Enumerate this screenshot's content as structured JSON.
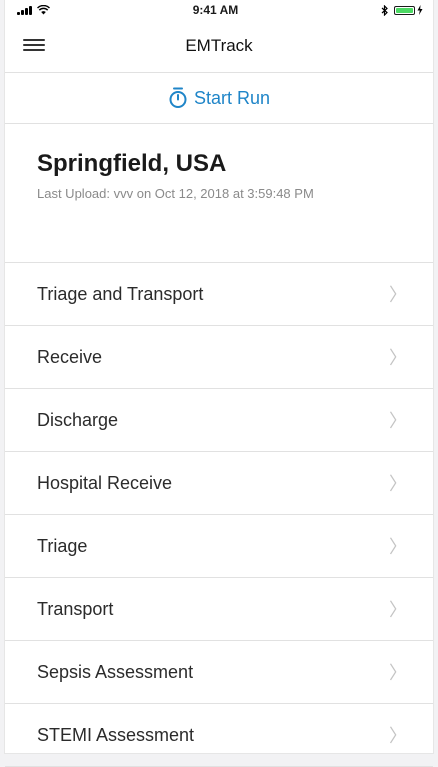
{
  "status_bar": {
    "time": "9:41 AM"
  },
  "nav": {
    "title": "EMTrack"
  },
  "actions": {
    "start_run": "Start Run"
  },
  "location": {
    "name": "Springfield, USA",
    "last_upload": "Last Upload: vvv on Oct 12, 2018 at 3:59:48 PM"
  },
  "menu_items": [
    {
      "label": "Triage and Transport"
    },
    {
      "label": "Receive"
    },
    {
      "label": "Discharge"
    },
    {
      "label": "Hospital Receive"
    },
    {
      "label": "Triage"
    },
    {
      "label": "Transport"
    },
    {
      "label": "Sepsis Assessment"
    },
    {
      "label": "STEMI Assessment"
    }
  ],
  "colors": {
    "accent": "#1f85c8",
    "battery": "#4cd964"
  },
  "icons": {
    "menu": "hamburger-menu-icon",
    "start_run": "stopwatch-icon",
    "chevron": "chevron-right-icon"
  }
}
